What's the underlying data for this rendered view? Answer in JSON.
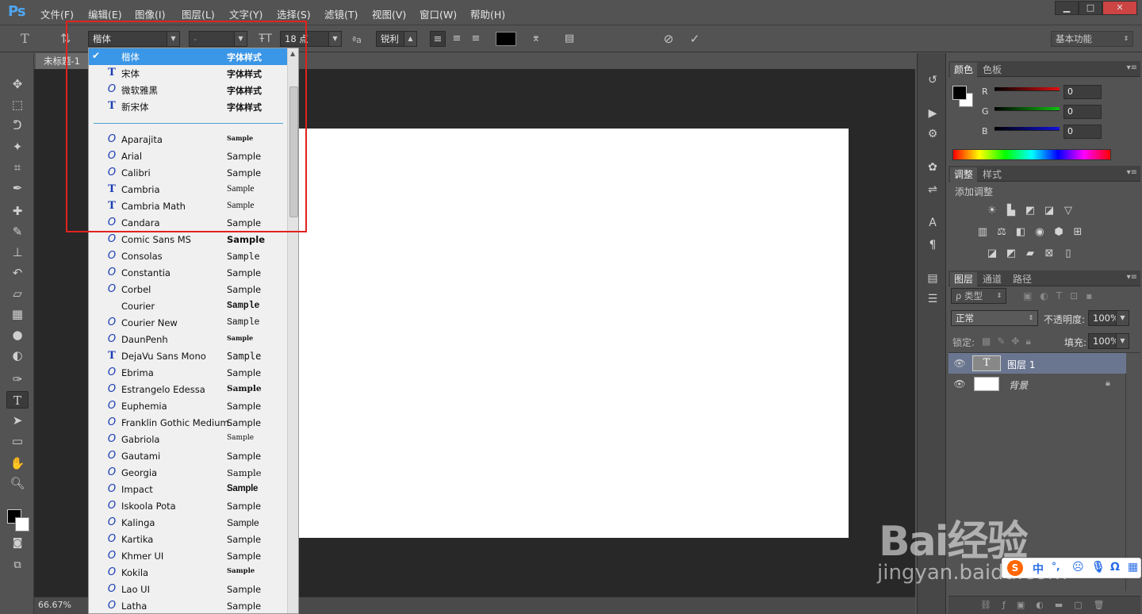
{
  "app": {
    "logo": "Ps"
  },
  "menu": [
    "文件(F)",
    "编辑(E)",
    "图像(I)",
    "图层(L)",
    "文字(Y)",
    "选择(S)",
    "滤镜(T)",
    "视图(V)",
    "窗口(W)",
    "帮助(H)"
  ],
  "window_controls": [
    "▁",
    "□",
    "✕"
  ],
  "options": {
    "font_family": "楷体",
    "font_style": "-",
    "font_size": "18 点",
    "antialias": "锐利",
    "workspace": "基本功能"
  },
  "document": {
    "tab_title": "未标题-1",
    "zoom": "66.67%"
  },
  "font_dropdown": {
    "selected_check": "✔",
    "recent": [
      {
        "name": "楷体",
        "sample": "字体样式",
        "glyph": "O",
        "kind": "ot",
        "selected": true
      },
      {
        "name": "宋体",
        "sample": "字体样式",
        "glyph": "T",
        "kind": "tt",
        "selected": false
      },
      {
        "name": "微软雅黑",
        "sample": "字体样式",
        "glyph": "O",
        "kind": "ot",
        "selected": false
      },
      {
        "name": "新宋体",
        "sample": "字体样式",
        "glyph": "T",
        "kind": "tt",
        "selected": false
      }
    ],
    "fonts": [
      {
        "name": "Aparajita",
        "sample": "Sample",
        "glyph": "O",
        "kind": "ot"
      },
      {
        "name": "Arial",
        "sample": "Sample",
        "glyph": "O",
        "kind": "ot"
      },
      {
        "name": "Calibri",
        "sample": "Sample",
        "glyph": "O",
        "kind": "ot"
      },
      {
        "name": "Cambria",
        "sample": "Sample",
        "glyph": "T",
        "kind": "tt"
      },
      {
        "name": "Cambria Math",
        "sample": "Sample",
        "glyph": "T",
        "kind": "tt"
      },
      {
        "name": "Candara",
        "sample": "Sample",
        "glyph": "O",
        "kind": "ot"
      },
      {
        "name": "Comic Sans MS",
        "sample": "Sample",
        "glyph": "O",
        "kind": "ot"
      },
      {
        "name": "Consolas",
        "sample": "Sample",
        "glyph": "O",
        "kind": "ot"
      },
      {
        "name": "Constantia",
        "sample": "Sample",
        "glyph": "O",
        "kind": "ot"
      },
      {
        "name": "Corbel",
        "sample": "Sample",
        "glyph": "O",
        "kind": "ot"
      },
      {
        "name": "Courier",
        "sample": "Sample",
        "glyph": "",
        "kind": "none"
      },
      {
        "name": "Courier New",
        "sample": "Sample",
        "glyph": "O",
        "kind": "ot"
      },
      {
        "name": "DaunPenh",
        "sample": "Sample",
        "glyph": "O",
        "kind": "ot"
      },
      {
        "name": "DejaVu Sans Mono",
        "sample": "Sample",
        "glyph": "T",
        "kind": "tt"
      },
      {
        "name": "Ebrima",
        "sample": "Sample",
        "glyph": "O",
        "kind": "ot"
      },
      {
        "name": "Estrangelo Edessa",
        "sample": "Sample",
        "glyph": "O",
        "kind": "ot"
      },
      {
        "name": "Euphemia",
        "sample": "Sample",
        "glyph": "O",
        "kind": "ot"
      },
      {
        "name": "Franklin Gothic Medium",
        "sample": "Sample",
        "glyph": "O",
        "kind": "ot"
      },
      {
        "name": "Gabriola",
        "sample": "Sample",
        "glyph": "O",
        "kind": "ot"
      },
      {
        "name": "Gautami",
        "sample": "Sample",
        "glyph": "O",
        "kind": "ot"
      },
      {
        "name": "Georgia",
        "sample": "Sample",
        "glyph": "O",
        "kind": "ot"
      },
      {
        "name": "Impact",
        "sample": "Sample",
        "glyph": "O",
        "kind": "ot"
      },
      {
        "name": "Iskoola Pota",
        "sample": "Sample",
        "glyph": "O",
        "kind": "ot"
      },
      {
        "name": "Kalinga",
        "sample": "Sample",
        "glyph": "O",
        "kind": "ot"
      },
      {
        "name": "Kartika",
        "sample": "Sample",
        "glyph": "O",
        "kind": "ot"
      },
      {
        "name": "Khmer UI",
        "sample": "Sample",
        "glyph": "O",
        "kind": "ot"
      },
      {
        "name": "Kokila",
        "sample": "Sample",
        "glyph": "O",
        "kind": "ot"
      },
      {
        "name": "Lao UI",
        "sample": "Sample",
        "glyph": "O",
        "kind": "ot"
      },
      {
        "name": "Latha",
        "sample": "Sample",
        "glyph": "O",
        "kind": "ot"
      }
    ]
  },
  "panels": {
    "color_tabs": [
      "颜色",
      "色板"
    ],
    "rgb": [
      {
        "label": "R",
        "value": "0",
        "color": "#e01010"
      },
      {
        "label": "G",
        "value": "0",
        "color": "#10c010"
      },
      {
        "label": "B",
        "value": "0",
        "color": "#1010e0"
      }
    ],
    "adjust_tabs": [
      "调整",
      "样式"
    ],
    "adjust_hint": "添加调整",
    "layers_tabs": [
      "图层",
      "通道",
      "路径"
    ],
    "kind_filter": "ρ 类型",
    "blend_mode": "正常",
    "opacity_label": "不透明度:",
    "opacity": "100%",
    "lock_label": "锁定:",
    "fill_label": "填充:",
    "fill": "100%",
    "layers": [
      {
        "name": "图层 1",
        "thumb": "T"
      },
      {
        "name": "背景",
        "thumb": ""
      }
    ]
  },
  "watermark": {
    "brand": "Bai经验",
    "url": "jingyan.baidu.com",
    "ime": "中"
  }
}
